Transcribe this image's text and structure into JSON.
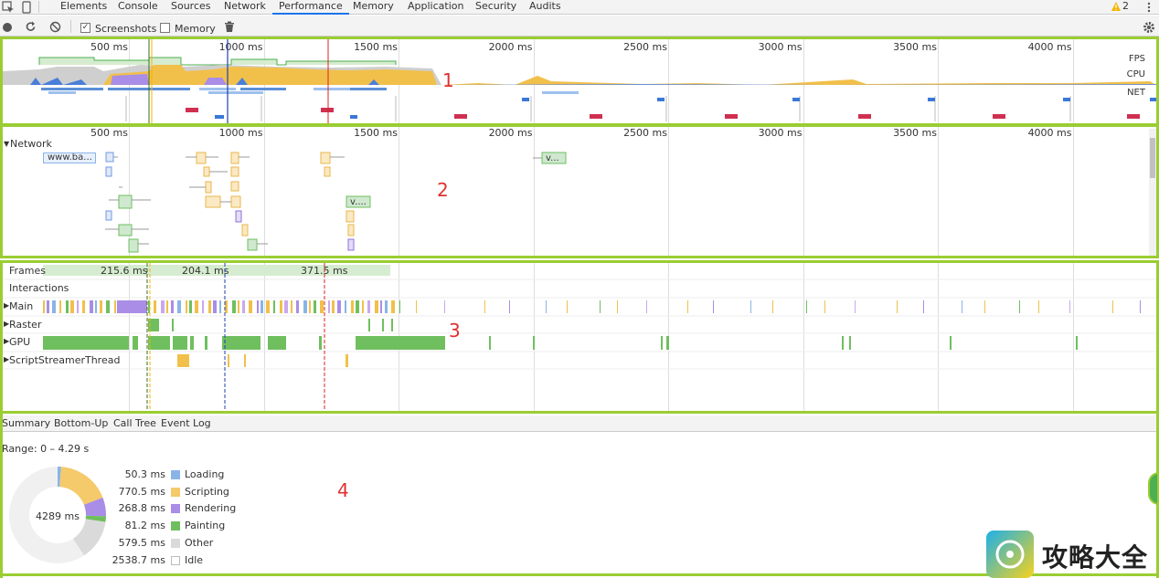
{
  "tabs": [
    "Elements",
    "Console",
    "Sources",
    "Network",
    "Performance",
    "Memory",
    "Application",
    "Security",
    "Audits"
  ],
  "active_tab": "Performance",
  "warnings_count": "2",
  "toolbar": {
    "screenshots_label": "Screenshots",
    "memory_label": "Memory"
  },
  "overview": {
    "ticks": [
      "500 ms",
      "1000 ms",
      "1500 ms",
      "2000 ms",
      "2500 ms",
      "3000 ms",
      "3500 ms",
      "4000 ms"
    ],
    "fps_label": "FPS",
    "cpu_label": "CPU",
    "net_label": "NET"
  },
  "network": {
    "ticks": [
      "500 ms",
      "1000 ms",
      "1500 ms",
      "2000 ms",
      "2500 ms",
      "3000 ms",
      "3500 ms",
      "4000 ms"
    ],
    "title": "Network",
    "first_request": "www.ba...",
    "request_v1": "v...",
    "request_v2": "v...."
  },
  "timeline": {
    "frames_label": "Frames",
    "frame_times": [
      "215.6 ms",
      "204.1 ms",
      "371.5 ms"
    ],
    "tracks": [
      "Interactions",
      "Main",
      "Raster",
      "GPU",
      "ScriptStreamerThread"
    ]
  },
  "summary": {
    "tabs": [
      "Summary",
      "Bottom-Up",
      "Call Tree",
      "Event Log"
    ],
    "range": "Range: 0 – 4.29 s",
    "total": "4289 ms",
    "legend": [
      {
        "value": "50.3 ms",
        "label": "Loading",
        "color": "#8ab4e8"
      },
      {
        "value": "770.5 ms",
        "label": "Scripting",
        "color": "#f5ca6b"
      },
      {
        "value": "268.8 ms",
        "label": "Rendering",
        "color": "#a98de6"
      },
      {
        "value": "81.2 ms",
        "label": "Painting",
        "color": "#6fbf5f"
      },
      {
        "value": "579.5 ms",
        "label": "Other",
        "color": "#dadada"
      },
      {
        "value": "2538.7 ms",
        "label": "Idle",
        "color": "#ffffff"
      }
    ]
  },
  "annotations": [
    "1",
    "2",
    "3",
    "4"
  ],
  "watermark": "攻略大全"
}
